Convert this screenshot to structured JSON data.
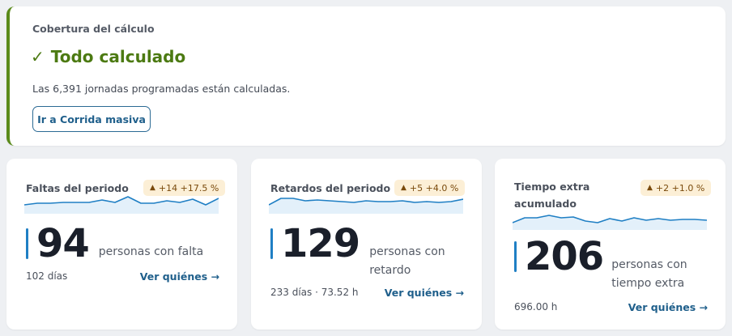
{
  "coverage": {
    "label": "Cobertura del cálculo",
    "check_icon": "✓",
    "title": "Todo calculado",
    "description": "Las 6,391 jornadas programadas están calculadas.",
    "button_label": "Ir a Corrida masiva"
  },
  "cards": [
    {
      "title": "Faltas del periodo",
      "badge_arrow": "▲",
      "badge_text": "+14 +17.5 %",
      "value": "94",
      "unit": "personas con falta",
      "footer": "102 días",
      "link": "Ver quiénes →",
      "sparkline": [
        0.55,
        0.45,
        0.45,
        0.4,
        0.4,
        0.4,
        0.25,
        0.4,
        0.05,
        0.45,
        0.45,
        0.3,
        0.4,
        0.2,
        0.55,
        0.15
      ]
    },
    {
      "title": "Retardos del periodo",
      "badge_arrow": "▲",
      "badge_text": "+5 +4.0 %",
      "value": "129",
      "unit": "personas con retardo",
      "footer": "233 días · 73.52 h",
      "link": "Ver quiénes →",
      "sparkline": [
        0.55,
        0.15,
        0.15,
        0.3,
        0.25,
        0.3,
        0.35,
        0.4,
        0.3,
        0.35,
        0.35,
        0.3,
        0.4,
        0.35,
        0.4,
        0.35,
        0.2
      ]
    },
    {
      "title": "Tiempo extra acumulado",
      "badge_arrow": "▲",
      "badge_text": "+2 +1.0 %",
      "value": "206",
      "unit": "personas con tiempo extra",
      "footer": "696.00 h",
      "link": "Ver quiénes →",
      "sparkline": [
        0.65,
        0.35,
        0.35,
        0.2,
        0.35,
        0.3,
        0.55,
        0.65,
        0.4,
        0.55,
        0.35,
        0.5,
        0.4,
        0.5,
        0.45,
        0.45,
        0.5
      ]
    }
  ],
  "colors": {
    "accent": "#1f7fc4",
    "success": "#4c7a12",
    "badge_bg": "#fcefd6",
    "sparkline": "#1f7fc4"
  }
}
